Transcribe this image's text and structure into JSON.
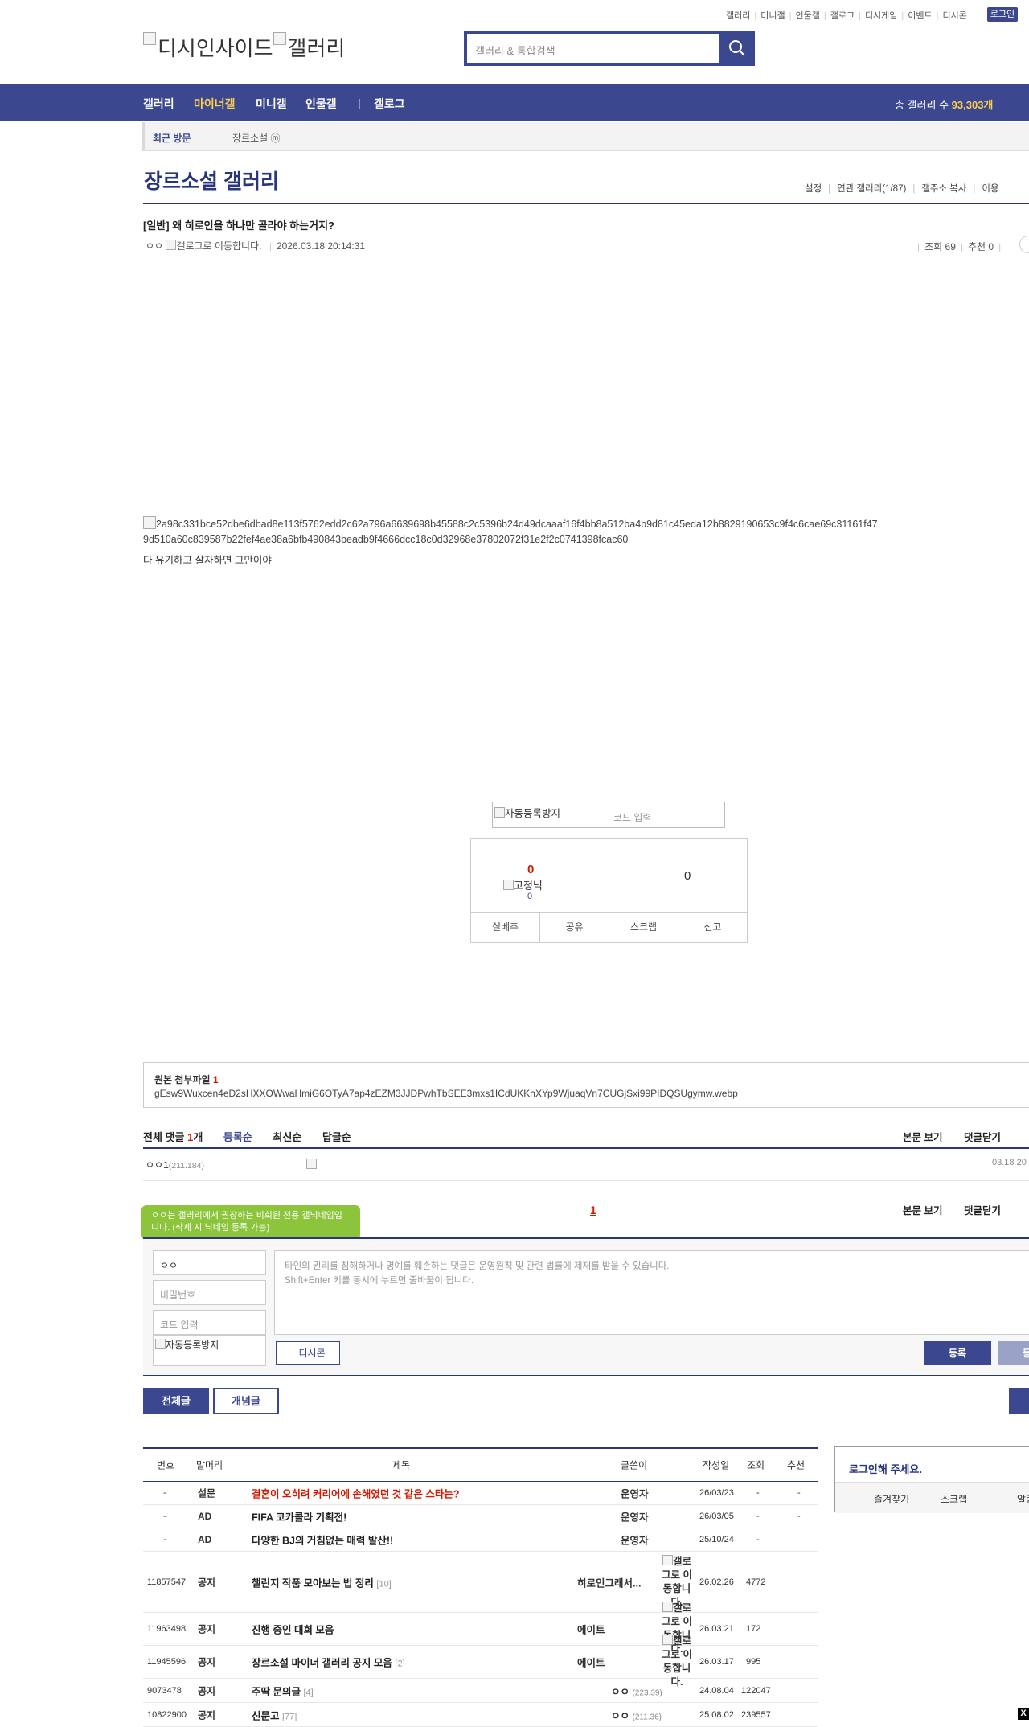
{
  "top_links": [
    "갤러리",
    "미니갤",
    "인물갤",
    "갤로그",
    "디시게임",
    "이벤트",
    "디시콘"
  ],
  "login_label": "로그인",
  "logo_text": [
    "디시인사이드",
    "갤러리"
  ],
  "search_placeholder": "갤러리 & 통합검색",
  "nav": {
    "items": [
      "갤러리",
      "마이너갤",
      "미니갤",
      "인물갤",
      "갤로그"
    ],
    "total_label": "총 갤러리 수",
    "total_value": "93,303개"
  },
  "recent": {
    "label": "최근 방문",
    "gallery": "장르소설 ⓜ"
  },
  "gallery_title": "장르소설 갤러리",
  "gallery_tabs": [
    "설정",
    "연관 갤러리(1/87)",
    "갤주소 복사",
    "이용"
  ],
  "post": {
    "title": "[일반] 왜 히로인을 하나만 골라야 하는거지?",
    "author": "ㅇㅇ",
    "author_img_alt": "갤로그로 이동합니다.",
    "date": "2026.03.18 20:14:31",
    "views_label": "조회 69",
    "recommend_label": "추천 0",
    "image_alt": "2a98c331bce52dbe6dbad8e113f5762edd2c62a796a6639698b45588c2c5396b24d49dcaaaf16f4bb8a512ba4b9d81c45eda12b8829190653c9f4c6cae69c31161f479d510a60c839587b22fef4ae38a6bfb490843beadb9f4666dcc18c0d32968e37802072f31e2f2c0741398fcac60",
    "body": "다 유기하고 살자하면 그만이야"
  },
  "captcha": {
    "img_alt": "자동등록방지",
    "placeholder": "코드 입력"
  },
  "vote": {
    "up": "0",
    "gonick_alt": "고정닉",
    "gonick_count": "0",
    "down": "0",
    "buttons": [
      "실베추",
      "공유",
      "스크랩",
      "신고"
    ]
  },
  "attachment": {
    "label": "원본 첨부파일",
    "count": "1",
    "filename": "gEsw9Wuxcen4eD2sHXXOWwaHmiG6OTyA7ap4zEZM3JJDPwhTbSEE3mxs1ICdUKKhXYp9WjuaqVn7CUGjSxi99PIDQSUgymw.webp"
  },
  "comments": {
    "total_label": "전체 댓글",
    "count": "1",
    "unit": "개",
    "orders": [
      "등록순",
      "최신순",
      "답글순"
    ],
    "view_body": "본문 보기",
    "close": "댓글닫기",
    "first": {
      "name": "ㅇㅇ",
      "num": "1",
      "ip": "(211.184)",
      "date": "03.18 20"
    },
    "page": "1"
  },
  "comment_form": {
    "tooltip": "ㅇㅇ는 갤러리에서 권장하는 비회원 전용 갤닉네임입니다. (삭제 시 닉네임 등록 가능)",
    "nickname": "ㅇㅇ",
    "password_placeholder": "비밀번호",
    "code_placeholder": "코드 입력",
    "captcha_alt": "자동등록방지",
    "textarea_placeholder": [
      "타인의 권리를 침해하거나 명예를 훼손하는 댓글은 운영원칙 및 관련 법률에 제재를 받을 수 있습니다.",
      "Shift+Enter 키를 동시에 누르면 줄바꿈이 됩니다."
    ],
    "dccon": "디시콘",
    "submit": "등록",
    "submit2": "등록"
  },
  "list_tabs": {
    "all": "전체글",
    "concept": "개념글"
  },
  "list": {
    "headers": [
      "번호",
      "말머리",
      "제목",
      "글쓴이",
      "작성일",
      "조회",
      "추천"
    ],
    "rows": [
      {
        "num": "-",
        "head": "설문",
        "subject": "결혼이 오히려 커리어에 손해였던 것 같은 스타는?",
        "replies": "",
        "writer": "운영자",
        "ip": "",
        "icon": "",
        "date": "26/03/23",
        "views": "-",
        "rec": "-",
        "red": true
      },
      {
        "num": "-",
        "head": "AD",
        "subject": "FIFA 코카콜라 기획전!",
        "replies": "",
        "writer": "운영자",
        "ip": "",
        "icon": "",
        "date": "26/03/05",
        "views": "-",
        "rec": "-",
        "red": false
      },
      {
        "num": "-",
        "head": "AD",
        "subject": "다양한 BJ의 거침없는 매력 발산!!",
        "replies": "",
        "writer": "운영자",
        "ip": "",
        "icon": "",
        "date": "25/10/24",
        "views": "-",
        "rec": "",
        "red": false
      },
      {
        "num": "11857547",
        "head": "공지",
        "subject": "챌린지 작품 모아보는 법 정리",
        "replies": "[10]",
        "writer": "히로인그래서...",
        "ip": "",
        "icon": "갤로그로 이동합니다.",
        "date": "26.02.26",
        "views": "4772",
        "rec": "",
        "red": false
      },
      {
        "num": "11963498",
        "head": "공지",
        "subject": "진행 중인 대회 모음",
        "replies": "",
        "writer": "에이트",
        "ip": "",
        "icon": "갤로그로 이동합니다.",
        "date": "26.03.21",
        "views": "172",
        "rec": "",
        "red": false
      },
      {
        "num": "11945596",
        "head": "공지",
        "subject": "장르소설 마이너 갤러리 공지 모음",
        "replies": "[2]",
        "writer": "에이트",
        "ip": "",
        "icon": "갤로그로 이동합니다.",
        "date": "26.03.17",
        "views": "995",
        "rec": "",
        "red": false
      },
      {
        "num": "9073478",
        "head": "공지",
        "subject": "주딱 문의글",
        "replies": "[4]",
        "writer": "ㅇㅇ",
        "ip": "(223.39)",
        "icon": "",
        "date": "24.08.04",
        "views": "122047",
        "rec": "",
        "red": false
      },
      {
        "num": "10822900",
        "head": "공지",
        "subject": "신문고",
        "replies": "[77]",
        "writer": "ㅇㅇ",
        "ip": "(211.36)",
        "icon": "",
        "date": "25.08.02",
        "views": "239557",
        "rec": "",
        "red": false
      }
    ]
  },
  "login_box": {
    "title": "로그인해 주세요.",
    "links": [
      "즐겨찾기",
      "스크랩",
      "알림"
    ]
  },
  "close_x": "X",
  "colors": {
    "primary": "#3b4890",
    "title": "#29367c",
    "accent_red": "#d31900",
    "nav_active": "#ffd14d",
    "tooltip": "#8cc43c"
  }
}
